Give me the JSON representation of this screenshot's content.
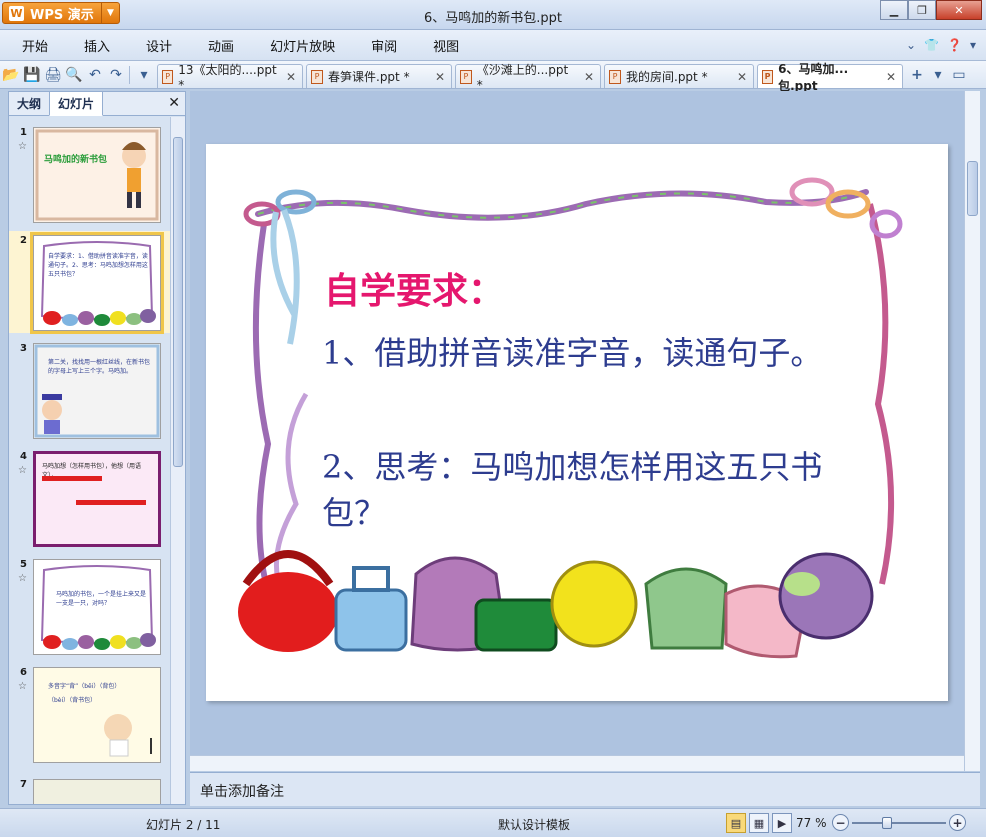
{
  "app": {
    "name": "WPS 演示",
    "logo_glyph": "W"
  },
  "window": {
    "title": "6、马鸣加的新书包.ppt"
  },
  "menu": [
    "开始",
    "插入",
    "设计",
    "动画",
    "幻灯片放映",
    "审阅",
    "视图"
  ],
  "doc_tabs": [
    {
      "label": "13《太阳的....ppt *",
      "active": false
    },
    {
      "label": "春笋课件.ppt *",
      "active": false
    },
    {
      "label": "《沙滩上的...ppt *",
      "active": false
    },
    {
      "label": "我的房间.ppt *",
      "active": false
    },
    {
      "label": "6、马鸣加...包.ppt",
      "active": true
    }
  ],
  "panel": {
    "tab_outline": "大纲",
    "tab_slides": "幻灯片"
  },
  "thumbnails": [
    {
      "num": "1",
      "star": "☆",
      "text": "马鸣加的新书包"
    },
    {
      "num": "2",
      "star": "",
      "text": "自学要求：1、借助拼音读准字音，读通句子。2、思考：马鸣加想怎样用这五只书包？"
    },
    {
      "num": "3",
      "star": "",
      "text": "第二关，找找用一根红丝线，在新书包的字母上写上三个字。马鸣加。"
    },
    {
      "num": "4",
      "star": "☆",
      "text": "马鸣加想（怎样用书包），他想（用语文），……"
    },
    {
      "num": "5",
      "star": "☆",
      "text": "马鸣加的书包，一个是挂上来又是一支是一只，对吗？"
    },
    {
      "num": "6",
      "star": "☆",
      "text": "多音字“背”（bēi）（背包）（bèi）（背书包）"
    },
    {
      "num": "7",
      "star": "",
      "text": ""
    }
  ],
  "slide": {
    "heading": "自学要求：",
    "line1": "1、借助拼音读准字音，读通句子。",
    "line2": "2、思考：马鸣加想怎样用这五只书包？"
  },
  "notes": {
    "placeholder": "单击添加备注"
  },
  "status": {
    "slide_info": "幻灯片 2 / 11",
    "template": "默认设计模板",
    "zoom": "77 %",
    "zoom_fraction": 0.36
  },
  "colors": {
    "accent": "#e0760b",
    "heading": "#e5176e",
    "body": "#2d3c8f"
  }
}
